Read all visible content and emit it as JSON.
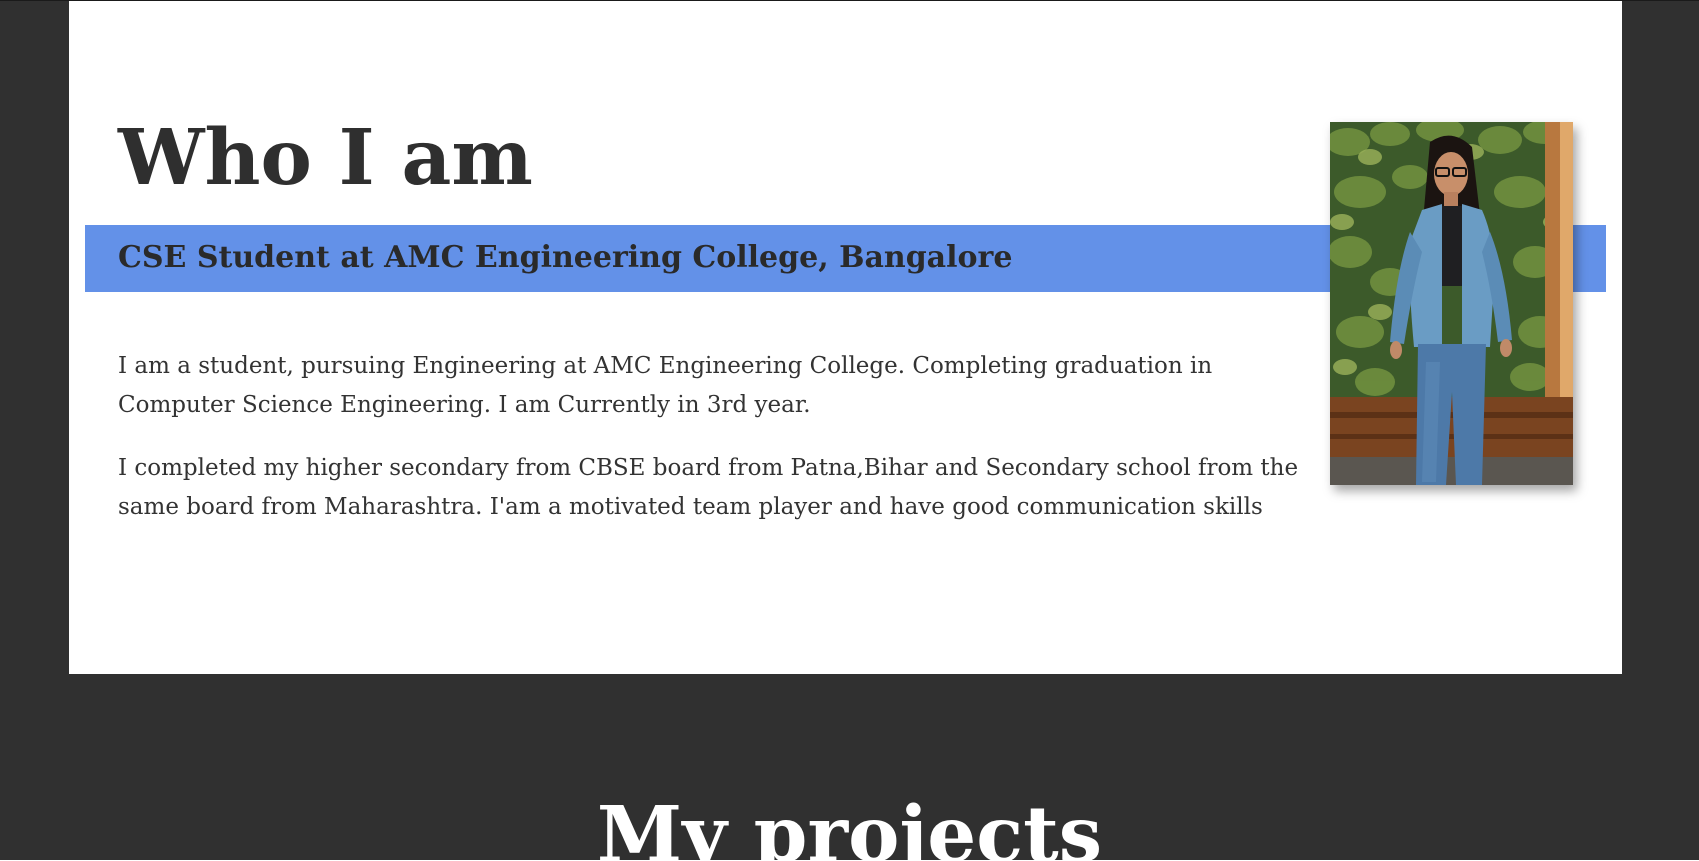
{
  "about": {
    "title": "Who I am",
    "subtitle": "CSE Student at AMC Engineering College, Bangalore",
    "paragraphs": [
      "I am a student, pursuing Engineering at AMC Engineering College. Completing graduation in Computer Science Engineering. I am Currently in 3rd year.",
      "I completed my higher secondary from CBSE board from Patna,Bihar and Secondary school from the same board from Maharashtra. I'am a motivated team player and have good communication skills"
    ],
    "photo_alt": "profile photo"
  },
  "projects": {
    "heading": "My projects"
  },
  "colors": {
    "page_background": "#303030",
    "card_background": "#ffffff",
    "accent_band": "#6391e8",
    "heading_text": "#2f2f2f",
    "body_text": "#333333"
  }
}
